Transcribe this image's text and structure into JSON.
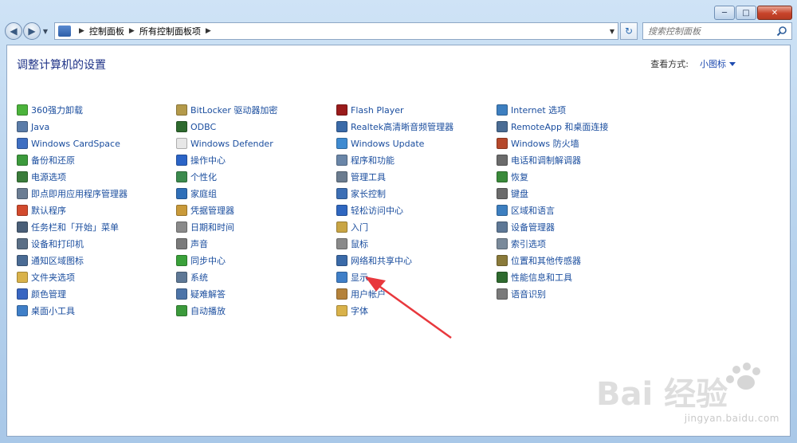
{
  "window": {
    "controls": [
      "─",
      "□",
      "✕"
    ]
  },
  "address": {
    "crumbs": [
      "控制面板",
      "所有控制面板项"
    ]
  },
  "search": {
    "placeholder": "搜索控制面板"
  },
  "page": {
    "title": "调整计算机的设置",
    "view_by_label": "查看方式:",
    "view_by_value": "小图标"
  },
  "columns": [
    [
      {
        "label": "360强力卸载",
        "icon": "uninstall-icon",
        "color": "#4bb33b"
      },
      {
        "label": "Java",
        "icon": "java-icon",
        "color": "#5b7ca8"
      },
      {
        "label": "Windows CardSpace",
        "icon": "cardspace-icon",
        "color": "#3f6fc2"
      },
      {
        "label": "备份和还原",
        "icon": "backup-icon",
        "color": "#3c9a3c"
      },
      {
        "label": "电源选项",
        "icon": "power-icon",
        "color": "#3a7c3a"
      },
      {
        "label": "即点即用应用程序管理器",
        "icon": "app-manager-icon",
        "color": "#6b7d93"
      },
      {
        "label": "默认程序",
        "icon": "default-programs-icon",
        "color": "#d24a2d"
      },
      {
        "label": "任务栏和「开始」菜单",
        "icon": "taskbar-icon",
        "color": "#4a5f78"
      },
      {
        "label": "设备和打印机",
        "icon": "printer-icon",
        "color": "#5b6f86"
      },
      {
        "label": "通知区域图标",
        "icon": "notification-icon",
        "color": "#4a6b94"
      },
      {
        "label": "文件夹选项",
        "icon": "folder-options-icon",
        "color": "#d9b24a"
      },
      {
        "label": "颜色管理",
        "icon": "color-management-icon",
        "color": "#3966c2"
      },
      {
        "label": "桌面小工具",
        "icon": "gadgets-icon",
        "color": "#3f7fc8"
      }
    ],
    [
      {
        "label": "BitLocker 驱动器加密",
        "icon": "bitlocker-icon",
        "color": "#b49a4a"
      },
      {
        "label": "ODBC",
        "icon": "odbc-icon",
        "color": "#2e6a2e"
      },
      {
        "label": "Windows Defender",
        "icon": "defender-icon",
        "color": "#e7e7e7"
      },
      {
        "label": "操作中心",
        "icon": "action-center-icon",
        "color": "#2b64c7"
      },
      {
        "label": "个性化",
        "icon": "personalization-icon",
        "color": "#3b8a4d"
      },
      {
        "label": "家庭组",
        "icon": "homegroup-icon",
        "color": "#2f6fb8"
      },
      {
        "label": "凭据管理器",
        "icon": "credential-icon",
        "color": "#c99a3a"
      },
      {
        "label": "日期和时间",
        "icon": "clock-icon",
        "color": "#8a8a8a"
      },
      {
        "label": "声音",
        "icon": "sound-icon",
        "color": "#7a7a7a"
      },
      {
        "label": "同步中心",
        "icon": "sync-icon",
        "color": "#3aa13a"
      },
      {
        "label": "系统",
        "icon": "system-icon",
        "color": "#5e7896"
      },
      {
        "label": "疑难解答",
        "icon": "troubleshoot-icon",
        "color": "#4d74a8"
      },
      {
        "label": "自动播放",
        "icon": "autoplay-icon",
        "color": "#3b9a3b"
      }
    ],
    [
      {
        "label": "Flash Player",
        "icon": "flash-icon",
        "color": "#9a1b1b"
      },
      {
        "label": "Realtek高清晰音频管理器",
        "icon": "realtek-icon",
        "color": "#3a6aa8"
      },
      {
        "label": "Windows Update",
        "icon": "windows-update-icon",
        "color": "#3f8bd1"
      },
      {
        "label": "程序和功能",
        "icon": "programs-icon",
        "color": "#6a86a8"
      },
      {
        "label": "管理工具",
        "icon": "admin-tools-icon",
        "color": "#6b7c8f"
      },
      {
        "label": "家长控制",
        "icon": "parental-controls-icon",
        "color": "#3d6fb5"
      },
      {
        "label": "轻松访问中心",
        "icon": "ease-of-access-icon",
        "color": "#2f67c0"
      },
      {
        "label": "入门",
        "icon": "getting-started-icon",
        "color": "#c9a544"
      },
      {
        "label": "鼠标",
        "icon": "mouse-icon",
        "color": "#8a8a8a"
      },
      {
        "label": "网络和共享中心",
        "icon": "network-icon",
        "color": "#3a6aa8"
      },
      {
        "label": "显示",
        "icon": "display-icon",
        "color": "#3f7fc8"
      },
      {
        "label": "用户帐户",
        "icon": "user-accounts-icon",
        "color": "#b5823a"
      },
      {
        "label": "字体",
        "icon": "fonts-icon",
        "color": "#d9b24a"
      }
    ],
    [
      {
        "label": "Internet 选项",
        "icon": "internet-options-icon",
        "color": "#3d7fc0"
      },
      {
        "label": "RemoteApp 和桌面连接",
        "icon": "remoteapp-icon",
        "color": "#4a6c94"
      },
      {
        "label": "Windows 防火墙",
        "icon": "firewall-icon",
        "color": "#b5482b"
      },
      {
        "label": "电话和调制解调器",
        "icon": "phone-modem-icon",
        "color": "#6b6b6b"
      },
      {
        "label": "恢复",
        "icon": "recovery-icon",
        "color": "#3a8a3a"
      },
      {
        "label": "键盘",
        "icon": "keyboard-icon",
        "color": "#6b6b6b"
      },
      {
        "label": "区域和语言",
        "icon": "region-icon",
        "color": "#3d7fc0"
      },
      {
        "label": "设备管理器",
        "icon": "device-manager-icon",
        "color": "#5e7896"
      },
      {
        "label": "索引选项",
        "icon": "indexing-icon",
        "color": "#7a8a9a"
      },
      {
        "label": "位置和其他传感器",
        "icon": "sensors-icon",
        "color": "#8a7a3a"
      },
      {
        "label": "性能信息和工具",
        "icon": "performance-icon",
        "color": "#2e6a2e"
      },
      {
        "label": "语音识别",
        "icon": "microphone-icon",
        "color": "#7a7a7a"
      }
    ]
  ],
  "watermark": {
    "brand": "Bai 经验",
    "url": "jingyan.baidu.com"
  },
  "annotation": {
    "arrow_color": "#e8383d"
  }
}
